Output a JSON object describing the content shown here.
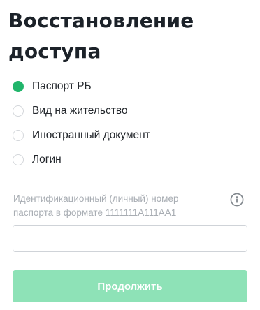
{
  "page": {
    "title": "Восстановление доступа"
  },
  "document_types": {
    "selected": "Паспорт РБ",
    "options": [
      {
        "label": "Паспорт РБ",
        "checked": true
      },
      {
        "label": "Вид на жительство",
        "checked": false
      },
      {
        "label": "Иностранный документ",
        "checked": false
      },
      {
        "label": "Логин",
        "checked": false
      }
    ]
  },
  "id_field": {
    "label": "Идентификационный (личный) номер паспорта в формате 1111111A111AA1",
    "value": "",
    "info_icon": "info-icon"
  },
  "actions": {
    "continue_label": "Продолжить"
  },
  "colors": {
    "accent": "#21b56b",
    "button_disabled": "#8ee2b7",
    "label_muted": "#a8adb3",
    "title": "#1c2229"
  }
}
